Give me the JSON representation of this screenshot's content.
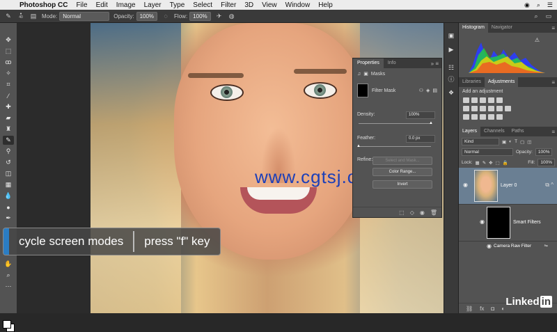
{
  "menubar": {
    "app": "Photoshop CC",
    "items": [
      "File",
      "Edit",
      "Image",
      "Layer",
      "Type",
      "Select",
      "Filter",
      "3D",
      "View",
      "Window",
      "Help"
    ]
  },
  "options": {
    "brush_size": "40",
    "mode_label": "Mode:",
    "mode_value": "Normal",
    "opacity_label": "Opacity:",
    "opacity_value": "100%",
    "flow_label": "Flow:",
    "flow_value": "100%"
  },
  "canvas": {
    "watermark": "www.cgtsj.com"
  },
  "caption": {
    "left": "cycle screen modes",
    "right": "press \"f\" key"
  },
  "properties": {
    "tabs": [
      "Properties",
      "Info"
    ],
    "section": "Masks",
    "mask_label": "Filter Mask",
    "density_label": "Density:",
    "density_value": "100%",
    "density_fraction": 1.0,
    "feather_label": "Feather:",
    "feather_value": "0.0 px",
    "feather_fraction": 0.0,
    "refine_label": "Refine:",
    "btn_select_mask": "Select and Mask...",
    "btn_color_range": "Color Range...",
    "btn_invert": "Invert"
  },
  "dock": {
    "histo_tabs": [
      "Histogram",
      "Navigator"
    ],
    "adj_tabs": [
      "Libraries",
      "Adjustments"
    ],
    "adj_title": "Add an adjustment",
    "layer_tabs": [
      "Layers",
      "Channels",
      "Paths"
    ],
    "kind": "Kind",
    "blend_mode": "Normal",
    "opacity_label": "Opacity:",
    "opacity_value": "100%",
    "lock_label": "Lock:",
    "fill_label": "Fill:",
    "fill_value": "100%",
    "layer0": "Layer 0",
    "smart_filters": "Smart Filters",
    "camera_raw": "Camera Raw Filter"
  },
  "brand": {
    "linkedin_text": "Linked",
    "linkedin_in": "in"
  },
  "colors": {
    "accent": "#2b7dc3",
    "selected_layer": "#6a7f93"
  }
}
